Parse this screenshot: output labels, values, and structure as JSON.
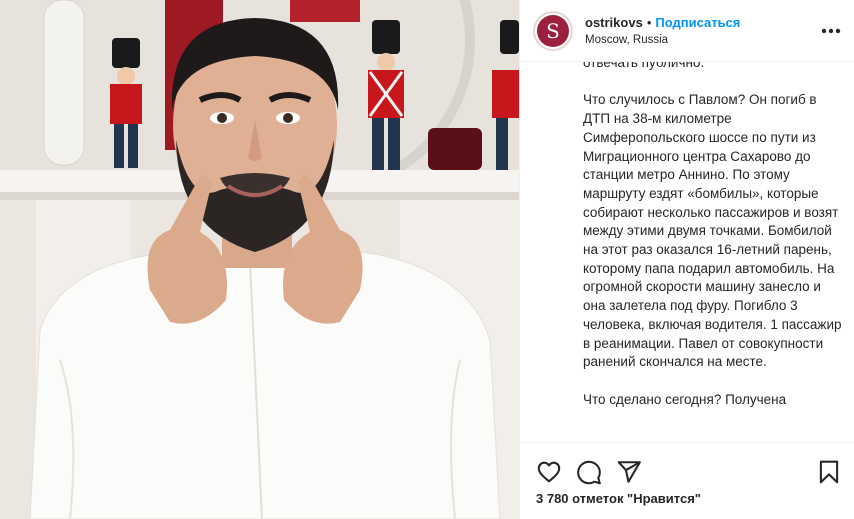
{
  "post": {
    "username": "ostrikovs",
    "separator": "•",
    "follow_label": "Подписаться",
    "location": "Moscow, Russia",
    "avatar_letter": "S",
    "more_label": "•••"
  },
  "caption": {
    "paragraphs": [
      "отвечать публично.",
      "Что случилось с Павлом? Он погиб в ДТП на 38-м километре Симферопольского шоссе по пути из Миграционного центра Сахарово до станции метро Аннино. По этому маршруту ездят «бомбилы», которые собирают несколько пассажиров и возят между этими двумя точками. Бомбилой на этот раз оказался 16-летний парень, которому папа подарил автомобиль. На огромной скорости машину занесло и она залетела под фуру. Погибло 3 человека, включая водителя. 1 пассажир в реанимации. Павел от совокупности ранений скончался на месте.",
      "Что сделано сегодня? Получена"
    ]
  },
  "actions": {
    "like_icon": "heart-icon",
    "comment_icon": "comment-icon",
    "share_icon": "paper-plane-icon",
    "save_icon": "bookmark-icon"
  },
  "likes": {
    "text": "3 780 отметок \"Нравится\""
  },
  "colors": {
    "accent": "#0095f6",
    "text": "#262626",
    "border": "#efefef"
  }
}
